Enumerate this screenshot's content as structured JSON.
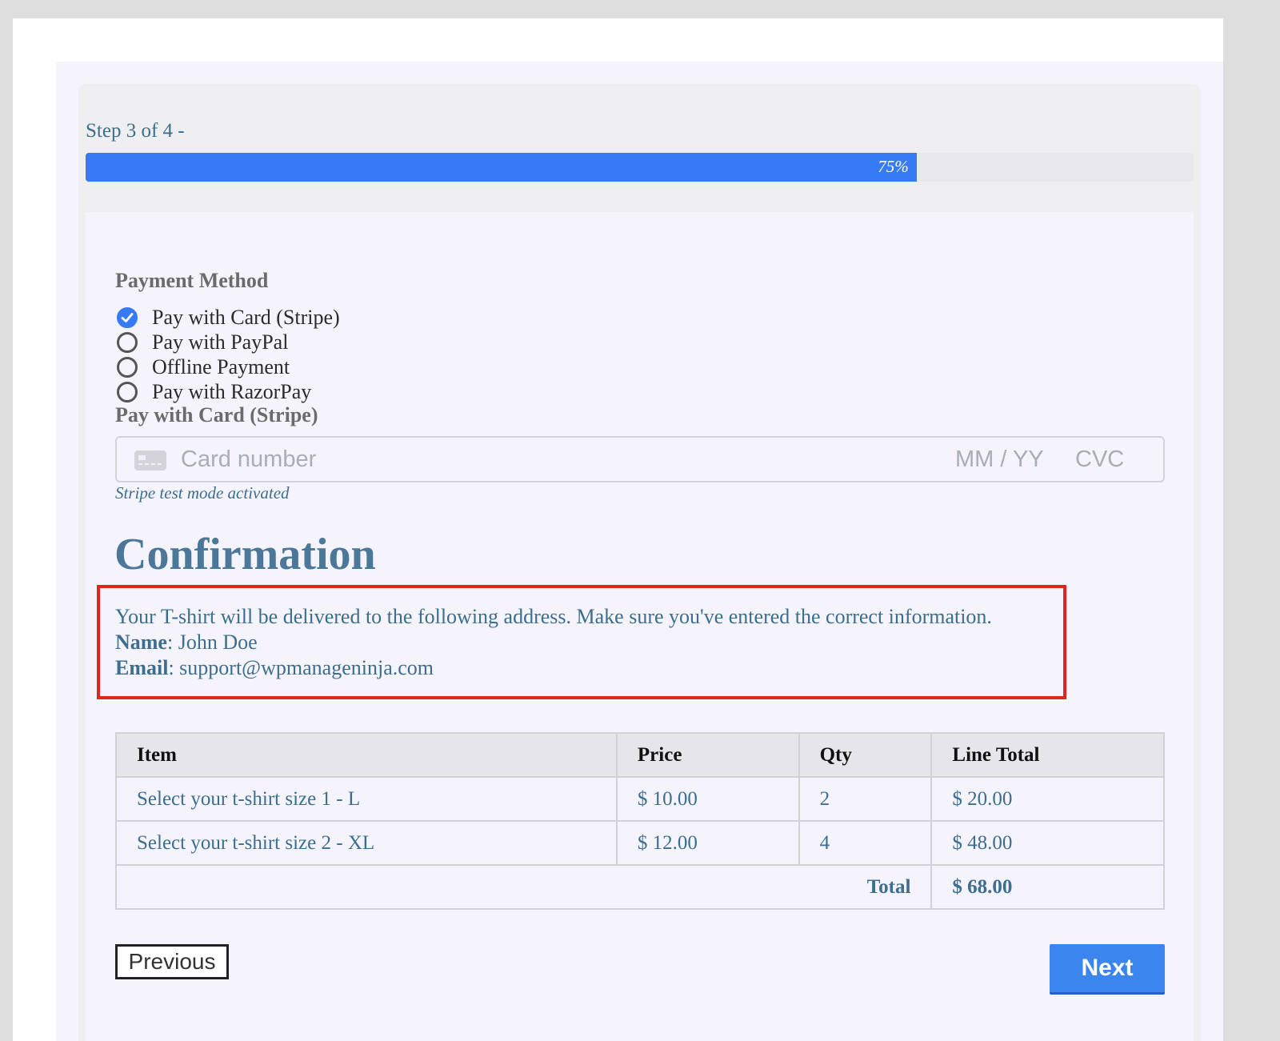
{
  "progress": {
    "step_label": "Step 3 of 4 -",
    "percent_text": "75%",
    "fraction": 0.75,
    "color": "#377bf4"
  },
  "payment": {
    "label": "Payment Method",
    "options": [
      {
        "label": "Pay with Card (Stripe)",
        "checked": true
      },
      {
        "label": "Pay with PayPal",
        "checked": false
      },
      {
        "label": "Offline Payment",
        "checked": false
      },
      {
        "label": "Pay with RazorPay",
        "checked": false
      }
    ]
  },
  "card": {
    "section_label": "Pay with Card (Stripe)",
    "icon": "credit-card-icon",
    "number_placeholder": "Card number",
    "expiry_placeholder": "MM / YY",
    "cvc_placeholder": "CVC",
    "note": "Stripe test mode activated"
  },
  "confirmation": {
    "heading": "Confirmation",
    "message": "Your T-shirt will be delivered to the following address. Make sure you've entered the correct information.",
    "name_label": "Name",
    "name_value": ": John Doe",
    "email_label": "Email",
    "email_value": ": support@wpmanageninja.com",
    "highlight_color": "#e0251b"
  },
  "order_table": {
    "headers": [
      "Item",
      "Price",
      "Qty",
      "Line Total"
    ],
    "rows": [
      [
        "Select your t-shirt size 1 - L",
        "$ 10.00",
        "2",
        "$ 20.00"
      ],
      [
        "Select your t-shirt size 2 - XL",
        "$ 12.00",
        "4",
        "$ 48.00"
      ]
    ],
    "total_label": "Total",
    "total_value": "$ 68.00"
  },
  "buttons": {
    "previous": "Previous",
    "next": "Next"
  }
}
